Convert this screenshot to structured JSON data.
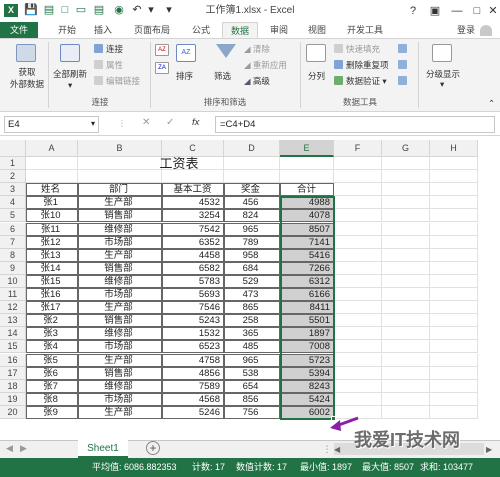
{
  "title_bar": {
    "title": "工作簿1.xlsx - Excel",
    "sign_in": "登录"
  },
  "tabs": [
    "文件",
    "开始",
    "插入",
    "页面布局",
    "公式",
    "数据",
    "审阅",
    "视图",
    "开发工具"
  ],
  "active_tab": "数据",
  "ribbon": {
    "get_external": [
      "获取",
      "外部数据"
    ],
    "refresh_all": "全部刷新",
    "connections": "连接",
    "properties": "属性",
    "edit_links": "编辑链接",
    "group_connections": "连接",
    "sort": "排序",
    "filter": "筛选",
    "clear": "清除",
    "reapply": "重新应用",
    "advanced": "高级",
    "group_sort_filter": "排序和筛选",
    "text_to_columns": "分列",
    "flash_fill": "快速填充",
    "remove_duplicates": "删除重复项",
    "data_validation": "数据验证",
    "group_data_tools": "数据工具",
    "outline": "分级显示"
  },
  "formula_bar": {
    "name_box": "E4",
    "fx": "fx",
    "formula": "=C4+D4"
  },
  "columns": [
    "A",
    "B",
    "C",
    "D",
    "E",
    "F",
    "G",
    "H"
  ],
  "selected_column": "E",
  "sheet": {
    "title": "工资表",
    "headers": [
      "姓名",
      "部门",
      "基本工资",
      "奖金",
      "合计"
    ],
    "rows": [
      [
        "张1",
        "生产部",
        "4532",
        "456",
        "4988"
      ],
      [
        "张10",
        "销售部",
        "3254",
        "824",
        "4078"
      ],
      [
        "张11",
        "维修部",
        "7542",
        "965",
        "8507"
      ],
      [
        "张12",
        "市场部",
        "6352",
        "789",
        "7141"
      ],
      [
        "张13",
        "生产部",
        "4458",
        "958",
        "5416"
      ],
      [
        "张14",
        "销售部",
        "6582",
        "684",
        "7266"
      ],
      [
        "张15",
        "维修部",
        "5783",
        "529",
        "6312"
      ],
      [
        "张16",
        "市场部",
        "5693",
        "473",
        "6166"
      ],
      [
        "张17",
        "生产部",
        "7546",
        "865",
        "8411"
      ],
      [
        "张2",
        "销售部",
        "5243",
        "258",
        "5501"
      ],
      [
        "张3",
        "维修部",
        "1532",
        "365",
        "1897"
      ],
      [
        "张4",
        "市场部",
        "6523",
        "485",
        "7008"
      ],
      [
        "张5",
        "生产部",
        "4758",
        "965",
        "5723"
      ],
      [
        "张6",
        "销售部",
        "4856",
        "538",
        "5394"
      ],
      [
        "张7",
        "维修部",
        "7589",
        "654",
        "8243"
      ],
      [
        "张8",
        "市场部",
        "4568",
        "856",
        "5424"
      ],
      [
        "张9",
        "生产部",
        "5246",
        "756",
        "6002"
      ]
    ]
  },
  "sheet_tab": "Sheet1",
  "status": {
    "average": "平均值: 6086.882353",
    "count": "计数: 17",
    "numeric_count": "数值计数: 17",
    "min": "最小值: 1897",
    "max": "最大值: 8507",
    "sum": "求和: 103477"
  },
  "watermark": "我爱IT技术网",
  "colors": {
    "accent": "#217346",
    "arrow": "#8b1fa8"
  }
}
